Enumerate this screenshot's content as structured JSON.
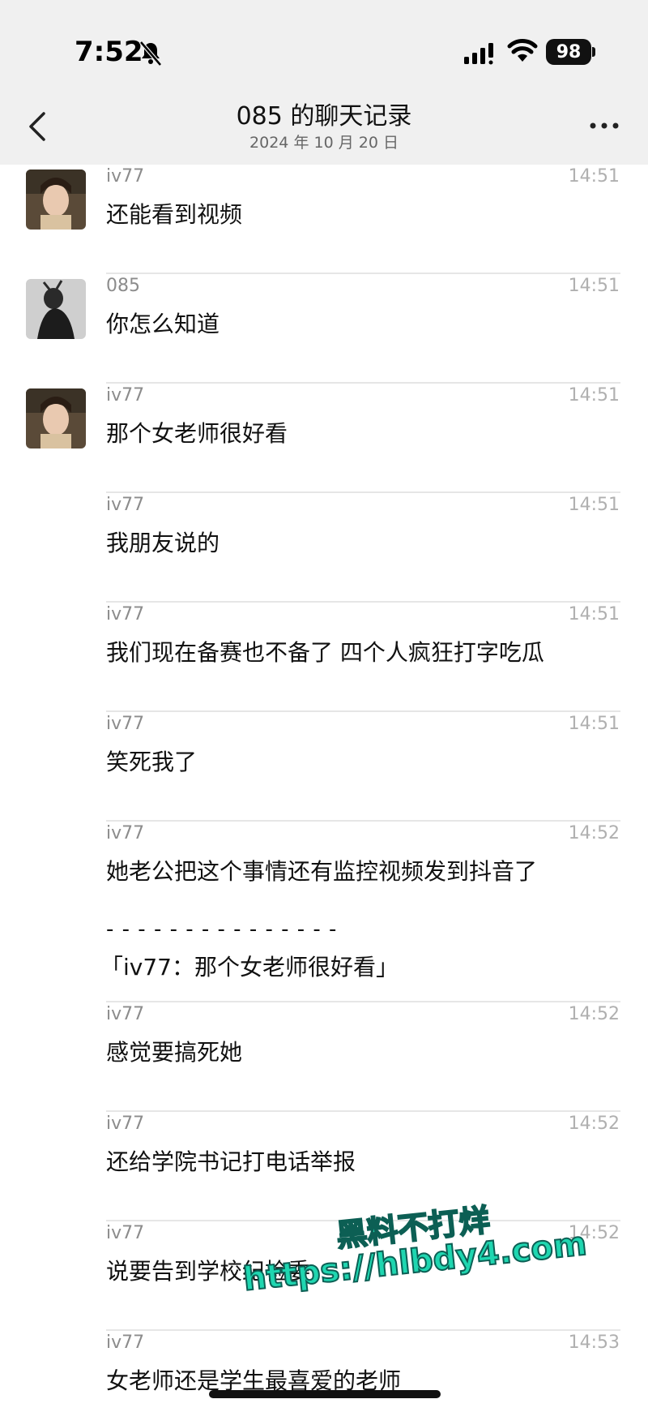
{
  "status": {
    "time": "7:52",
    "battery": "98"
  },
  "header": {
    "title": "085 的聊天记录",
    "subtitle": "2024 年 10 月 20 日"
  },
  "messages": [
    {
      "sender": "iv77",
      "time": "14:51",
      "text": "还能看到视频",
      "avatar": "girl"
    },
    {
      "sender": "085",
      "time": "14:51",
      "text": "你怎么知道",
      "avatar": "dark"
    },
    {
      "sender": "iv77",
      "time": "14:51",
      "text": "那个女老师很好看",
      "avatar": "girl"
    },
    {
      "sender": "iv77",
      "time": "14:51",
      "text": "我朋友说的"
    },
    {
      "sender": "iv77",
      "time": "14:51",
      "text": "我们现在备赛也不备了 四个人疯狂打字吃瓜"
    },
    {
      "sender": "iv77",
      "time": "14:51",
      "text": "笑死我了"
    },
    {
      "sender": "iv77",
      "time": "14:52",
      "text": "她老公把这个事情还有监控视频发到抖音了",
      "quote_line": "- - - - - - - - - - - - - - -",
      "quote": "「iv77：那个女老师很好看」"
    },
    {
      "sender": "iv77",
      "time": "14:52",
      "text": "感觉要搞死她"
    },
    {
      "sender": "iv77",
      "time": "14:52",
      "text": "还给学院书记打电话举报"
    },
    {
      "sender": "iv77",
      "time": "14:52",
      "text": "说要告到学校纪检委"
    },
    {
      "sender": "iv77",
      "time": "14:53",
      "text": "女老师还是学生最喜爱的老师"
    }
  ],
  "watermark": {
    "line1": "黑料不打烊",
    "line2": "https://hlbdy4.com"
  },
  "icons": {
    "mute": "bell-slash-icon",
    "signal": "cellular-signal-icon",
    "wifi": "wifi-icon",
    "back": "chevron-left-icon",
    "more": "ellipsis-icon"
  }
}
